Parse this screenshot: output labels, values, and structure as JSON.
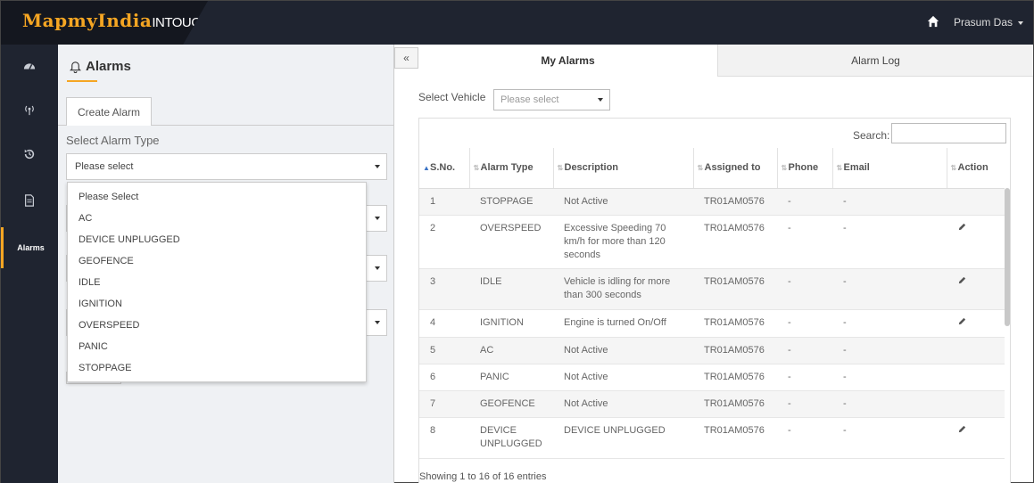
{
  "header": {
    "brand": "MapmyIndia",
    "product": "INTOUCH",
    "product_sup": "(r)",
    "user_name": "Prasum Das"
  },
  "sidebar": {
    "items": [
      {
        "icon": "dashboard-icon"
      },
      {
        "icon": "signal-icon"
      },
      {
        "icon": "history-icon"
      },
      {
        "icon": "document-icon"
      },
      {
        "label": "Alarms",
        "active": true
      }
    ],
    "accent_color": "#f5a623"
  },
  "left_panel": {
    "title": "Alarms",
    "tab_label": "Create Alarm",
    "select_label": "Select Alarm Type",
    "select_value": "Please select",
    "dropdown_options": [
      "Please Select",
      "AC",
      "DEVICE UNPLUGGED",
      "GEOFENCE",
      "IDLE",
      "IGNITION",
      "OVERSPEED",
      "PANIC",
      "STOPPAGE"
    ]
  },
  "main": {
    "collapse_label": "«",
    "tabs": [
      {
        "label": "My Alarms",
        "active": true
      },
      {
        "label": "Alarm Log",
        "active": false
      }
    ],
    "vehicle_label": "Select Vehicle",
    "vehicle_placeholder": "Please select",
    "search_label": "Search:",
    "columns": [
      "S.No.",
      "Alarm Type",
      "Description",
      "Assigned to",
      "Phone",
      "Email",
      "Action"
    ],
    "rows": [
      {
        "sno": "1",
        "type": "STOPPAGE",
        "desc": "Not Active",
        "assigned": "TR01AM0576",
        "phone": "-",
        "email": "-",
        "edit": false
      },
      {
        "sno": "2",
        "type": "OVERSPEED",
        "desc": "Excessive Speeding 70 km/h for more than 120 seconds",
        "assigned": "TR01AM0576",
        "phone": "-",
        "email": "-",
        "edit": true
      },
      {
        "sno": "3",
        "type": "IDLE",
        "desc": "Vehicle is idling for more than 300 seconds",
        "assigned": "TR01AM0576",
        "phone": "-",
        "email": "-",
        "edit": true
      },
      {
        "sno": "4",
        "type": "IGNITION",
        "desc": "Engine is turned On/Off",
        "assigned": "TR01AM0576",
        "phone": "-",
        "email": "-",
        "edit": true
      },
      {
        "sno": "5",
        "type": "AC",
        "desc": "Not Active",
        "assigned": "TR01AM0576",
        "phone": "-",
        "email": "-",
        "edit": false
      },
      {
        "sno": "6",
        "type": "PANIC",
        "desc": "Not Active",
        "assigned": "TR01AM0576",
        "phone": "-",
        "email": "-",
        "edit": false
      },
      {
        "sno": "7",
        "type": "GEOFENCE",
        "desc": "Not Active",
        "assigned": "TR01AM0576",
        "phone": "-",
        "email": "-",
        "edit": false
      },
      {
        "sno": "8",
        "type": "DEVICE UNPLUGGED",
        "desc": "DEVICE UNPLUGGED",
        "assigned": "TR01AM0576",
        "phone": "-",
        "email": "-",
        "edit": true
      }
    ],
    "footer": "Showing 1 to 16 of 16 entries"
  }
}
